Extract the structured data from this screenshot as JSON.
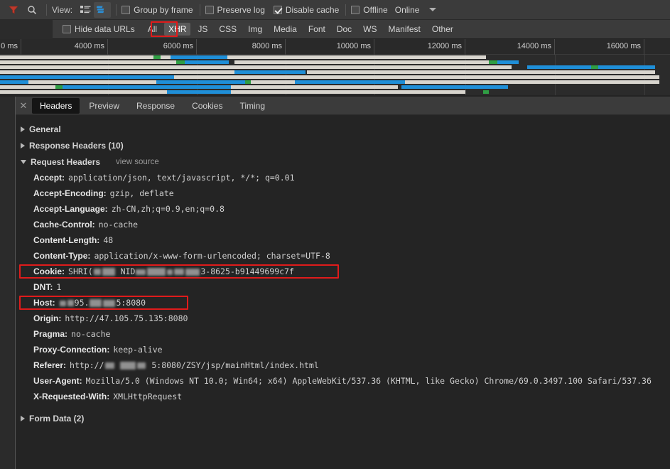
{
  "toolbar": {
    "filter_icon": "filter-funnel-icon",
    "search_icon": "search-icon",
    "view_label": "View:",
    "view_list_icon": "list-view-icon",
    "view_waterfall_icon": "waterfall-view-icon",
    "group_by_frame_label": "Group by frame",
    "preserve_log_label": "Preserve log",
    "disable_cache_label": "Disable cache",
    "offline_label": "Offline",
    "throttle_value": "Online",
    "caret_icon": "chevron-down-icon",
    "group_by_frame_checked": false,
    "preserve_log_checked": false,
    "disable_cache_checked": true,
    "offline_checked": false
  },
  "filterbar": {
    "filter_placeholder": "",
    "filter_value": "",
    "hide_data_urls_label": "Hide data URLs",
    "hide_data_urls_checked": false,
    "types": [
      {
        "label": "All",
        "selected": false
      },
      {
        "label": "XHR",
        "selected": true
      },
      {
        "label": "JS",
        "selected": false
      },
      {
        "label": "CSS",
        "selected": false
      },
      {
        "label": "Img",
        "selected": false
      },
      {
        "label": "Media",
        "selected": false
      },
      {
        "label": "Font",
        "selected": false
      },
      {
        "label": "Doc",
        "selected": false
      },
      {
        "label": "WS",
        "selected": false
      },
      {
        "label": "Manifest",
        "selected": false
      },
      {
        "label": "Other",
        "selected": false
      }
    ]
  },
  "timeline": {
    "ticks": [
      "0 ms",
      "4000 ms",
      "6000 ms",
      "8000 ms",
      "10000 ms",
      "12000 ms",
      "14000 ms",
      "16000 ms"
    ],
    "colors": {
      "wait": "#d8d5ce",
      "download": "#1f8fd8",
      "ttfb": "#2f9e44"
    }
  },
  "detail": {
    "close_icon": "close-icon",
    "tabs": [
      {
        "label": "Headers",
        "active": true
      },
      {
        "label": "Preview",
        "active": false
      },
      {
        "label": "Response",
        "active": false
      },
      {
        "label": "Cookies",
        "active": false
      },
      {
        "label": "Timing",
        "active": false
      }
    ],
    "sections": [
      {
        "label": "General",
        "expanded": false
      },
      {
        "label": "Response Headers (10)",
        "expanded": false
      },
      {
        "label": "Request Headers",
        "expanded": true,
        "view_source_label": "view source"
      }
    ],
    "request_headers": [
      {
        "name": "Accept:",
        "value": "application/json, text/javascript, */*; q=0.01",
        "highlight": false
      },
      {
        "name": "Accept-Encoding:",
        "value": "gzip, deflate",
        "highlight": false
      },
      {
        "name": "Accept-Language:",
        "value": "zh-CN,zh;q=0.9,en;q=0.8",
        "highlight": false
      },
      {
        "name": "Cache-Control:",
        "value": "no-cache",
        "highlight": false
      },
      {
        "name": "Content-Length:",
        "value": "48",
        "highlight": false
      },
      {
        "name": "Content-Type:",
        "value": "application/x-www-form-urlencoded; charset=UTF-8",
        "highlight": false
      },
      {
        "name": "Cookie:",
        "value": "SHRI( ██ NID█ ███ █ ██ █3-8625-b91449699c7f",
        "highlight": true,
        "redacted": true
      },
      {
        "name": "DNT:",
        "value": "1",
        "highlight": false
      },
      {
        "name": "Host:",
        "value": "█ █95.█ █5:8080",
        "highlight": true,
        "redacted": true
      },
      {
        "name": "Origin:",
        "value": "http://47.105.75.135:8080",
        "highlight": false
      },
      {
        "name": "Pragma:",
        "value": "no-cache",
        "highlight": false
      },
      {
        "name": "Proxy-Connection:",
        "value": "keep-alive",
        "highlight": false
      },
      {
        "name": "Referer:",
        "value": "http://█ ██ █ █5:8080/ZSY/jsp/mainHtml/index.html",
        "highlight": false,
        "redacted": true
      },
      {
        "name": "User-Agent:",
        "value": "Mozilla/5.0 (Windows NT 10.0; Win64; x64) AppleWebKit/537.36 (KHTML, like Gecko) Chrome/69.0.3497.100 Safari/537.36",
        "highlight": false
      },
      {
        "name": "X-Requested-With:",
        "value": "XMLHttpRequest",
        "highlight": false
      }
    ],
    "form_data_section": {
      "label": "Form Data (2)",
      "expanded": false
    }
  },
  "colors": {
    "accent_red": "#e01b1b",
    "toolbar_bg": "#3b3b3b",
    "panel_bg": "#242424",
    "blue_bar": "#1f8fd8",
    "green_bar": "#2f9e44"
  }
}
